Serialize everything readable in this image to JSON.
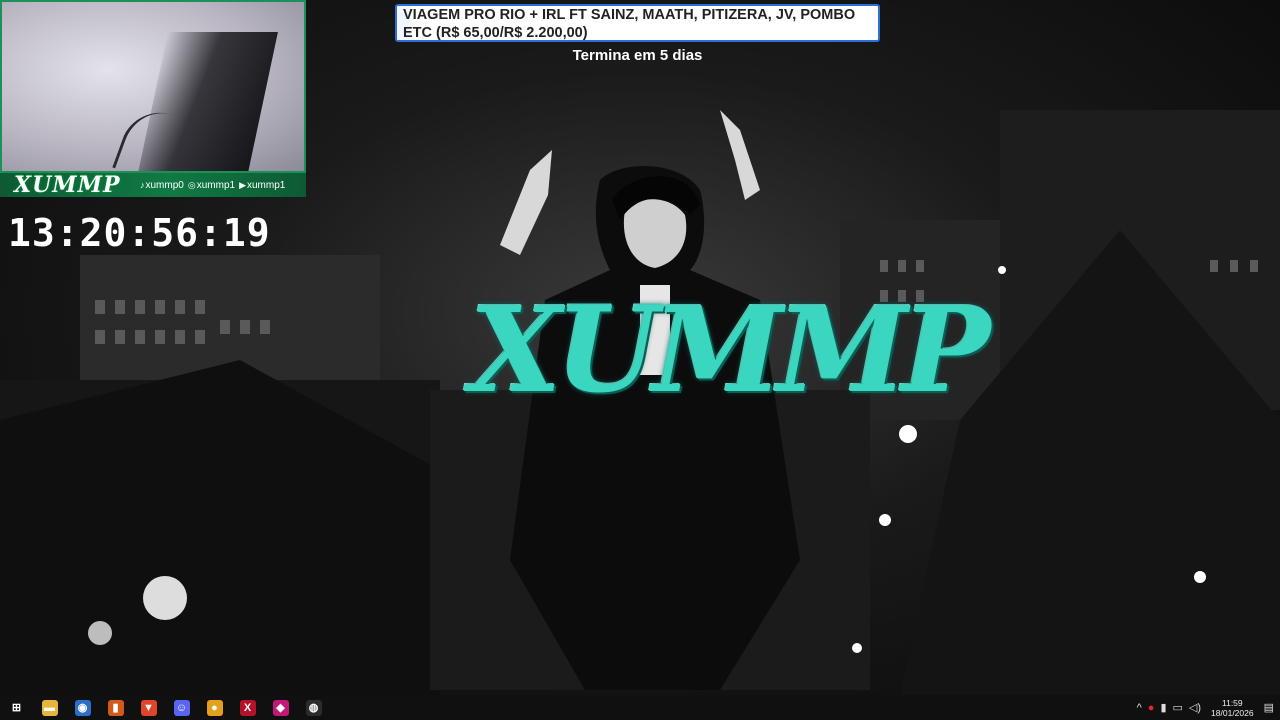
{
  "stream": {
    "brand_logo": "XUMMP",
    "socials": [
      {
        "icon": "tiktok-icon",
        "glyph": "♪",
        "handle": "xummp0"
      },
      {
        "icon": "instagram-icon",
        "glyph": "◎",
        "handle": "xummp1"
      },
      {
        "icon": "youtube-icon",
        "glyph": "▶",
        "handle": "xummp1"
      }
    ],
    "timer": "13:20:56:19",
    "center_logo": "XUMMP"
  },
  "goal": {
    "title": "VIAGEM PRO RIO + IRL FT SAINZ, MAATH, PITIZERA, JV, POMBO ETC (R$ 65,00/R$ 2.200,00)",
    "progress_fraction": 0.03,
    "ends_in": "Termina em 5 dias",
    "colors": {
      "border": "#2d6fd8",
      "background": "#ffffff"
    }
  },
  "taskbar": {
    "apps": [
      {
        "name": "start",
        "icon": "windows-start-icon",
        "glyph": "⊞",
        "color": "#101010"
      },
      {
        "name": "file-explorer",
        "icon": "folder-icon",
        "glyph": "▬",
        "color": "#e8b53a"
      },
      {
        "name": "app-blue",
        "icon": "globe-icon",
        "glyph": "◉",
        "color": "#2b6fc9"
      },
      {
        "name": "task-manager",
        "icon": "chart-icon",
        "glyph": "▮",
        "color": "#d25a1b"
      },
      {
        "name": "brave",
        "icon": "brave-browser-icon",
        "glyph": "▼",
        "color": "#e0452a"
      },
      {
        "name": "discord",
        "icon": "discord-icon",
        "glyph": "☺",
        "color": "#5865f2"
      },
      {
        "name": "chrome",
        "icon": "chrome-icon",
        "glyph": "●",
        "color": "#e4a11b"
      },
      {
        "name": "app-x",
        "icon": "x-app-icon",
        "glyph": "X",
        "color": "#b3122a"
      },
      {
        "name": "app-pink",
        "icon": "pink-app-icon",
        "glyph": "◆",
        "color": "#c2187a"
      },
      {
        "name": "obs",
        "icon": "obs-icon",
        "glyph": "◍",
        "color": "#2b2b2b"
      }
    ],
    "tray": {
      "time": "11:59",
      "date": "18/01/2026",
      "icons": [
        "chevron-up-icon",
        "record-icon",
        "mic-icon",
        "network-icon",
        "volume-icon"
      ]
    }
  }
}
